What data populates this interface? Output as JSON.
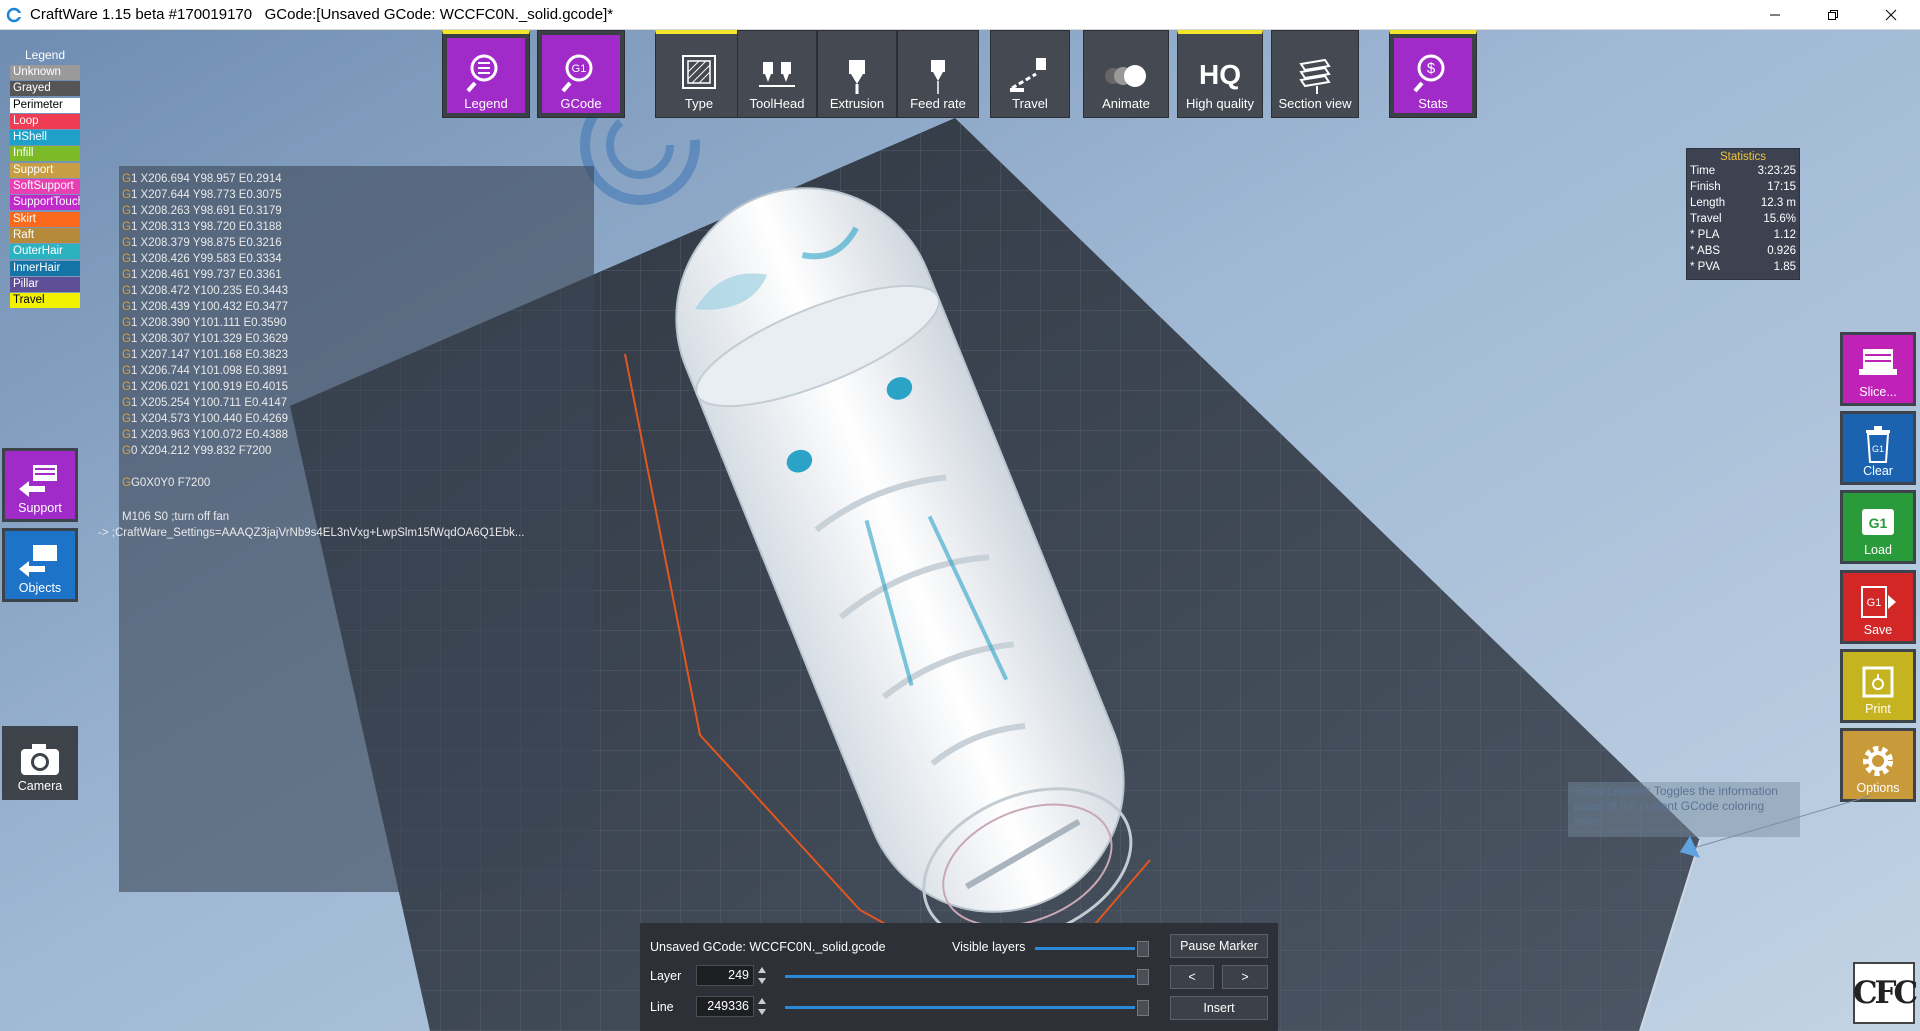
{
  "window": {
    "title": "CraftWare 1.15 beta #170019170   GCode:[Unsaved GCode: WCCFC0N._solid.gcode]*",
    "minimize_icon": "minimize-icon",
    "maximize_icon": "restore-icon",
    "close_icon": "close-icon"
  },
  "toolbar": {
    "legend": "Legend",
    "gcode": "GCode",
    "type": "Type",
    "toolhead": "ToolHead",
    "extrusion": "Extrusion",
    "feedrate": "Feed rate",
    "travel": "Travel",
    "animate": "Animate",
    "hq": "HQ",
    "high_quality": "High quality",
    "section_view": "Section view",
    "stats": "Stats"
  },
  "legend": {
    "title": "Legend",
    "items": [
      {
        "label": "Unknown",
        "color": "#9a9a9a",
        "text": "#ffffff"
      },
      {
        "label": "Grayed",
        "color": "#555555",
        "text": "#ffffff"
      },
      {
        "label": "Perimeter",
        "color": "#ffffff",
        "text": "#000000"
      },
      {
        "label": "Loop",
        "color": "#ef3b54",
        "text": "#ffffff"
      },
      {
        "label": "HShell",
        "color": "#1ea1c8",
        "text": "#ffffff"
      },
      {
        "label": "Infill",
        "color": "#7dba28",
        "text": "#ffffff"
      },
      {
        "label": "Support",
        "color": "#c79e43",
        "text": "#ffffff"
      },
      {
        "label": "SoftSupport",
        "color": "#e93fb3",
        "text": "#ffffff"
      },
      {
        "label": "SupportTouch",
        "color": "#c12acb",
        "text": "#ffffff"
      },
      {
        "label": "Skirt",
        "color": "#fb6a1c",
        "text": "#ffffff"
      },
      {
        "label": "Raft",
        "color": "#b58a3b",
        "text": "#ffffff"
      },
      {
        "label": "OuterHair",
        "color": "#2ab2c1",
        "text": "#ffffff"
      },
      {
        "label": "InnerHair",
        "color": "#1574a6",
        "text": "#ffffff"
      },
      {
        "label": "Pillar",
        "color": "#5e5096",
        "text": "#ffffff"
      },
      {
        "label": "Travel",
        "color": "#f2f200",
        "text": "#000000"
      }
    ]
  },
  "gcode": {
    "lines": [
      {
        "cmd": "G",
        "rest": "1 X206.694 Y98.957 E0.2914"
      },
      {
        "cmd": "G",
        "rest": "1 X207.644 Y98.773 E0.3075"
      },
      {
        "cmd": "G",
        "rest": "1 X208.263 Y98.691 E0.3179"
      },
      {
        "cmd": "G",
        "rest": "1 X208.313 Y98.720 E0.3188"
      },
      {
        "cmd": "G",
        "rest": "1 X208.379 Y98.875 E0.3216"
      },
      {
        "cmd": "G",
        "rest": "1 X208.426 Y99.583 E0.3334"
      },
      {
        "cmd": "G",
        "rest": "1 X208.461 Y99.737 E0.3361"
      },
      {
        "cmd": "G",
        "rest": "1 X208.472 Y100.235 E0.3443"
      },
      {
        "cmd": "G",
        "rest": "1 X208.439 Y100.432 E0.3477"
      },
      {
        "cmd": "G",
        "rest": "1 X208.390 Y101.111 E0.3590"
      },
      {
        "cmd": "G",
        "rest": "1 X208.307 Y101.329 E0.3629"
      },
      {
        "cmd": "G",
        "rest": "1 X207.147 Y101.168 E0.3823"
      },
      {
        "cmd": "G",
        "rest": "1 X206.744 Y101.098 E0.3891"
      },
      {
        "cmd": "G",
        "rest": "1 X206.021 Y100.919 E0.4015"
      },
      {
        "cmd": "G",
        "rest": "1 X205.254 Y100.711 E0.4147"
      },
      {
        "cmd": "G",
        "rest": "1 X204.573 Y100.440 E0.4269"
      },
      {
        "cmd": "G",
        "rest": "1 X203.963 Y100.072 E0.4388"
      },
      {
        "cmd": "G",
        "rest": "0 X204.212 Y99.832 F7200"
      }
    ],
    "line_g0": "G0X0Y0 F7200",
    "line_m106": "M106 S0 ;turn off fan",
    "line_settings_arrow": "->",
    "line_settings": ";CraftWare_Settings=AAAQZ3jajVrNb9s4EL3nVxg+LwpSlm15fWqdOA6Q1Ebk..."
  },
  "stats": {
    "title": "Statistics",
    "rows": [
      {
        "k": "Time",
        "v": "3:23:25"
      },
      {
        "k": "Finish",
        "v": "17:15"
      },
      {
        "k": "Length",
        "v": "12.3 m"
      },
      {
        "k": "Travel",
        "v": "15.6%"
      },
      {
        "k": "* PLA",
        "v": "1.12"
      },
      {
        "k": "* ABS",
        "v": "0.926"
      },
      {
        "k": "* PVA",
        "v": "1.85"
      }
    ]
  },
  "left_buttons": {
    "support": "Support",
    "objects": "Objects",
    "camera": "Camera"
  },
  "right_buttons": {
    "slice": "Slice...",
    "clear": "Clear",
    "load": "Load",
    "save": "Save",
    "print": "Print",
    "options": "Options"
  },
  "bottom": {
    "filename": "Unsaved GCode: WCCFC0N._solid.gcode",
    "visible_layers": "Visible layers",
    "layer_label": "Layer",
    "layer_value": "249",
    "line_label": "Line",
    "line_value": "249336",
    "pause_marker": "Pause Marker",
    "prev": "<",
    "next": ">",
    "insert": "Insert"
  },
  "tooltip": "Show Legend: Toggles the information panel of the current GCode coloring style.",
  "logo": "CFC",
  "colors": {
    "accent_purple": "#a12bc9",
    "slider_blue": "#2a89d8",
    "active_yellow": "#f2e52a"
  }
}
